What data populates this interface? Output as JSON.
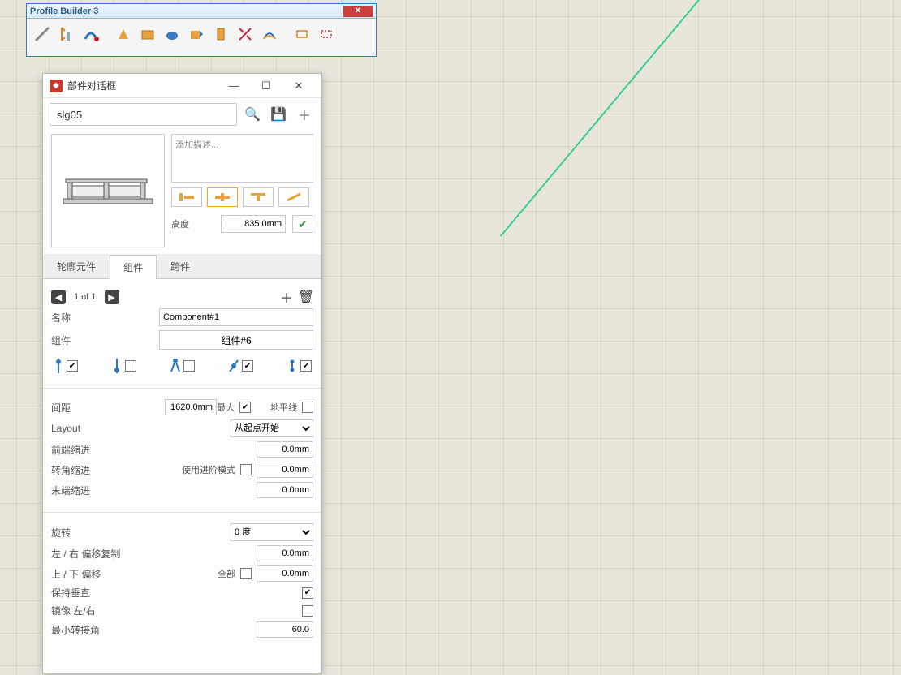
{
  "toolbar": {
    "title": "Profile Builder 3",
    "tools": [
      "profile",
      "height",
      "follow",
      "extrude",
      "box",
      "push",
      "paint",
      "stamp",
      "trim",
      "mirror",
      "path",
      "rect-a",
      "rect-b"
    ]
  },
  "dialog": {
    "title": "部件对话框",
    "search_value": "slg05",
    "desc_placeholder": "添加描述...",
    "height_label": "高度",
    "height_value": "835.0mm",
    "tabs": {
      "profile": "轮廓元件",
      "component": "组件",
      "span": "跨件"
    },
    "pager": "1 of 1",
    "name_label": "名称",
    "name_value": "Component#1",
    "comp_label": "组件",
    "comp_button": "组件#6",
    "spacing_label": "间距",
    "spacing_value": "1620.0mm",
    "max_label": "最大",
    "horizon_label": "地平线",
    "layout_label": "Layout",
    "layout_value": "从起点开始",
    "front_indent_label": "前端缩进",
    "front_indent_value": "0.0mm",
    "corner_indent_label": "转角缩进",
    "corner_step_label": "使用进阶模式",
    "corner_indent_value": "0.0mm",
    "end_indent_label": "末端缩进",
    "end_indent_value": "0.0mm",
    "rotate_label": "旋转",
    "rotate_value": "0 度",
    "lr_offset_label": "左 / 右 偏移复制",
    "lr_offset_value": "0.0mm",
    "ud_offset_label": "上 / 下 偏移",
    "all_label": "全部",
    "ud_offset_value": "0.0mm",
    "keep_vertical_label": "保持垂直",
    "mirror_lr_label": "镜像 左/右",
    "min_turn_label": "最小转接角",
    "min_turn_value": "60.0"
  }
}
